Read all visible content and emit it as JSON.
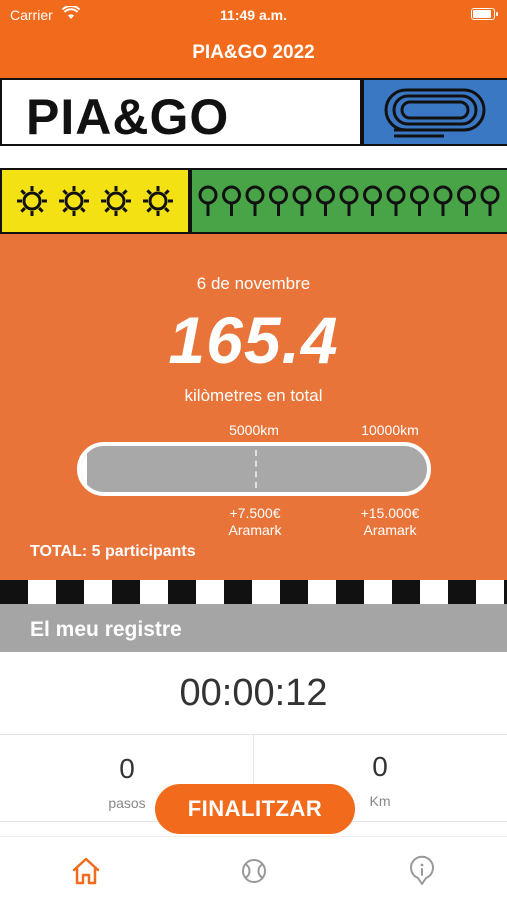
{
  "status_bar": {
    "carrier": "Carrier",
    "time": "11:49 a.m."
  },
  "nav": {
    "title": "PIA&GO 2022"
  },
  "banner": {
    "logo": "PIA&GO",
    "yellow_icons": 4,
    "green_icons": 13
  },
  "progress": {
    "date": "6 de novembre",
    "total_km": "165.4",
    "total_label": "kilòmetres en total",
    "goal1_label": "5000km",
    "goal2_label": "10000km",
    "reward1_amount": "+7.500€",
    "reward1_sponsor": "Aramark",
    "reward2_amount": "+15.000€",
    "reward2_sponsor": "Aramark",
    "fill_fraction": 0.0165,
    "participants": "TOTAL: 5 participants"
  },
  "registre": {
    "title": "El meu registre"
  },
  "timer": {
    "value": "00:00:12"
  },
  "stats": {
    "steps_value": "0",
    "steps_unit": "pasos",
    "km_value": "0",
    "km_unit": "Km"
  },
  "actions": {
    "finish_label": "FINALITZAR"
  },
  "tabs": [
    {
      "icon": "home-icon",
      "active": true
    },
    {
      "icon": "tennis-ball-icon",
      "active": false
    },
    {
      "icon": "info-icon",
      "active": false
    }
  ],
  "colors": {
    "accent": "#f26a1b",
    "orange_panel": "#e8743a",
    "yellow": "#f3e114",
    "green": "#49a448",
    "blue": "#3b78c4",
    "grey": "#a5a5a5"
  }
}
